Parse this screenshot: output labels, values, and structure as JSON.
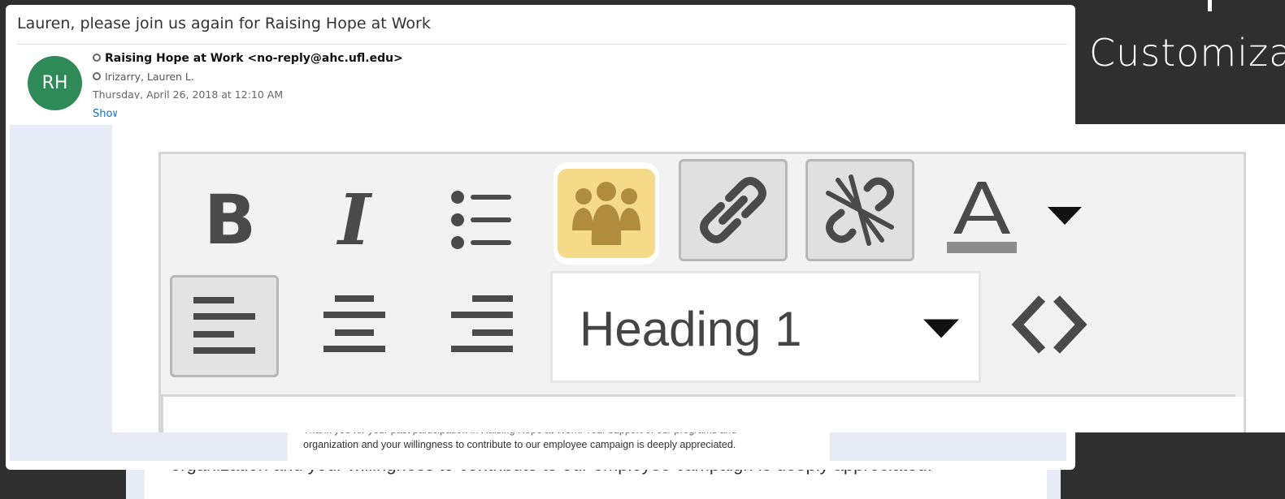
{
  "slide": {
    "title": "Customizati"
  },
  "email": {
    "subject": "Lauren, please join us again for Raising Hope at Work",
    "avatar_initials": "RH",
    "from": "Raising Hope at Work <no-reply@ahc.ufl.edu>",
    "to": "Irizarry, Lauren L.",
    "date": "Thursday, April 26, 2018 at 12:10 AM",
    "show_link": "Show Details",
    "body_text": "organization and your willingness to contribute to our employee campaign is deeply appreciated.",
    "body_text_partial": "Thank you for your past participation in Raising Hope at Work. Your support of our programs and"
  },
  "toolbar": {
    "bold_label": "B",
    "italic_label": "I",
    "format_value": "Heading 1",
    "font_color_hex": "#8c8c8c",
    "group_button_bg": "#f5da8a",
    "group_icon_color": "#b08d3c",
    "icons": [
      "bold-icon",
      "italic-icon",
      "bulleted-list-icon",
      "group-icon",
      "link-icon",
      "unlink-icon",
      "font-color-icon",
      "chevron-down-icon",
      "align-left-icon",
      "align-center-icon",
      "align-right-icon",
      "source-code-icon"
    ]
  },
  "zoomed_body": {
    "text": "organization and your willingness to contribute to our employee campaign is deeply appreciated."
  }
}
